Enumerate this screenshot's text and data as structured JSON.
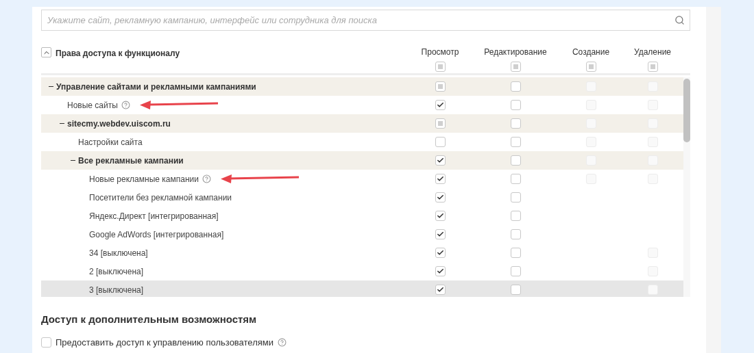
{
  "search": {
    "placeholder": "Укажите сайт, рекламную кампанию, интерфейс или сотрудника для поиска"
  },
  "permissions": {
    "title": "Права доступа к функционалу",
    "expanded": true,
    "columns": [
      {
        "label": "Просмотр",
        "kind": "partial"
      },
      {
        "label": "Редактирование",
        "kind": "partial"
      },
      {
        "label": "Создание",
        "kind": "partial"
      },
      {
        "label": "Удаление",
        "kind": "partial"
      }
    ],
    "tree": [
      {
        "label": "Управление сайтами и рекламными кампаниями",
        "expanded": true,
        "hovered": false,
        "help": false,
        "arrow": false,
        "cells": [
          {
            "kind": "partial"
          },
          {
            "kind": "empty"
          },
          {
            "kind": "disabled"
          },
          {
            "kind": "disabled"
          }
        ],
        "children": [
          {
            "label": "Новые сайты",
            "hovered": false,
            "help": true,
            "arrow": true,
            "cells": [
              {
                "kind": "checked"
              },
              {
                "kind": "empty"
              },
              {
                "kind": "disabled"
              },
              {
                "kind": "disabled"
              }
            ]
          },
          {
            "label": "sitecmy.webdev.uiscom.ru",
            "expanded": true,
            "hovered": false,
            "help": false,
            "arrow": false,
            "cells": [
              {
                "kind": "partial"
              },
              {
                "kind": "empty"
              },
              {
                "kind": "disabled"
              },
              {
                "kind": "disabled"
              }
            ],
            "children": [
              {
                "label": "Настройки сайта",
                "hovered": false,
                "help": false,
                "arrow": false,
                "cells": [
                  {
                    "kind": "empty"
                  },
                  {
                    "kind": "empty"
                  },
                  {
                    "kind": "disabled"
                  },
                  {
                    "kind": "disabled"
                  }
                ]
              },
              {
                "label": "Все рекламные кампании",
                "expanded": true,
                "hovered": false,
                "help": false,
                "arrow": false,
                "cells": [
                  {
                    "kind": "checked"
                  },
                  {
                    "kind": "empty"
                  },
                  {
                    "kind": "disabled"
                  },
                  {
                    "kind": "disabled"
                  }
                ],
                "children": [
                  {
                    "label": "Новые рекламные кампании",
                    "hovered": false,
                    "help": true,
                    "arrow": true,
                    "cells": [
                      {
                        "kind": "checked"
                      },
                      {
                        "kind": "empty"
                      },
                      {
                        "kind": "disabled"
                      },
                      {
                        "kind": "disabled"
                      }
                    ]
                  },
                  {
                    "label": "Посетители без рекламной кампании",
                    "hovered": false,
                    "help": false,
                    "arrow": false,
                    "cells": [
                      {
                        "kind": "checked"
                      },
                      {
                        "kind": "empty"
                      },
                      {
                        "kind": "none"
                      },
                      {
                        "kind": "none"
                      }
                    ]
                  },
                  {
                    "label": "Яндекс.Директ [интегрированная]",
                    "hovered": false,
                    "help": false,
                    "arrow": false,
                    "cells": [
                      {
                        "kind": "checked"
                      },
                      {
                        "kind": "empty"
                      },
                      {
                        "kind": "none"
                      },
                      {
                        "kind": "none"
                      }
                    ]
                  },
                  {
                    "label": "Google AdWords [интегрированная]",
                    "hovered": false,
                    "help": false,
                    "arrow": false,
                    "cells": [
                      {
                        "kind": "checked"
                      },
                      {
                        "kind": "empty"
                      },
                      {
                        "kind": "none"
                      },
                      {
                        "kind": "none"
                      }
                    ]
                  },
                  {
                    "label": "34 [выключена]",
                    "hovered": false,
                    "help": false,
                    "arrow": false,
                    "cells": [
                      {
                        "kind": "checked"
                      },
                      {
                        "kind": "empty"
                      },
                      {
                        "kind": "none"
                      },
                      {
                        "kind": "disabled"
                      }
                    ]
                  },
                  {
                    "label": "2 [выключена]",
                    "hovered": false,
                    "help": false,
                    "arrow": false,
                    "cells": [
                      {
                        "kind": "checked"
                      },
                      {
                        "kind": "empty"
                      },
                      {
                        "kind": "none"
                      },
                      {
                        "kind": "disabled"
                      }
                    ]
                  },
                  {
                    "label": "3 [выключена]",
                    "hovered": true,
                    "help": false,
                    "arrow": false,
                    "cells": [
                      {
                        "kind": "checked"
                      },
                      {
                        "kind": "empty"
                      },
                      {
                        "kind": "none"
                      },
                      {
                        "kind": "disabled"
                      }
                    ]
                  }
                ]
              }
            ]
          }
        ]
      }
    ]
  },
  "extra": {
    "title": "Доступ к дополнительным возможностям",
    "options": [
      {
        "label": "Предоставить доступ к управлению пользователями",
        "checked": false,
        "help": true
      }
    ]
  }
}
